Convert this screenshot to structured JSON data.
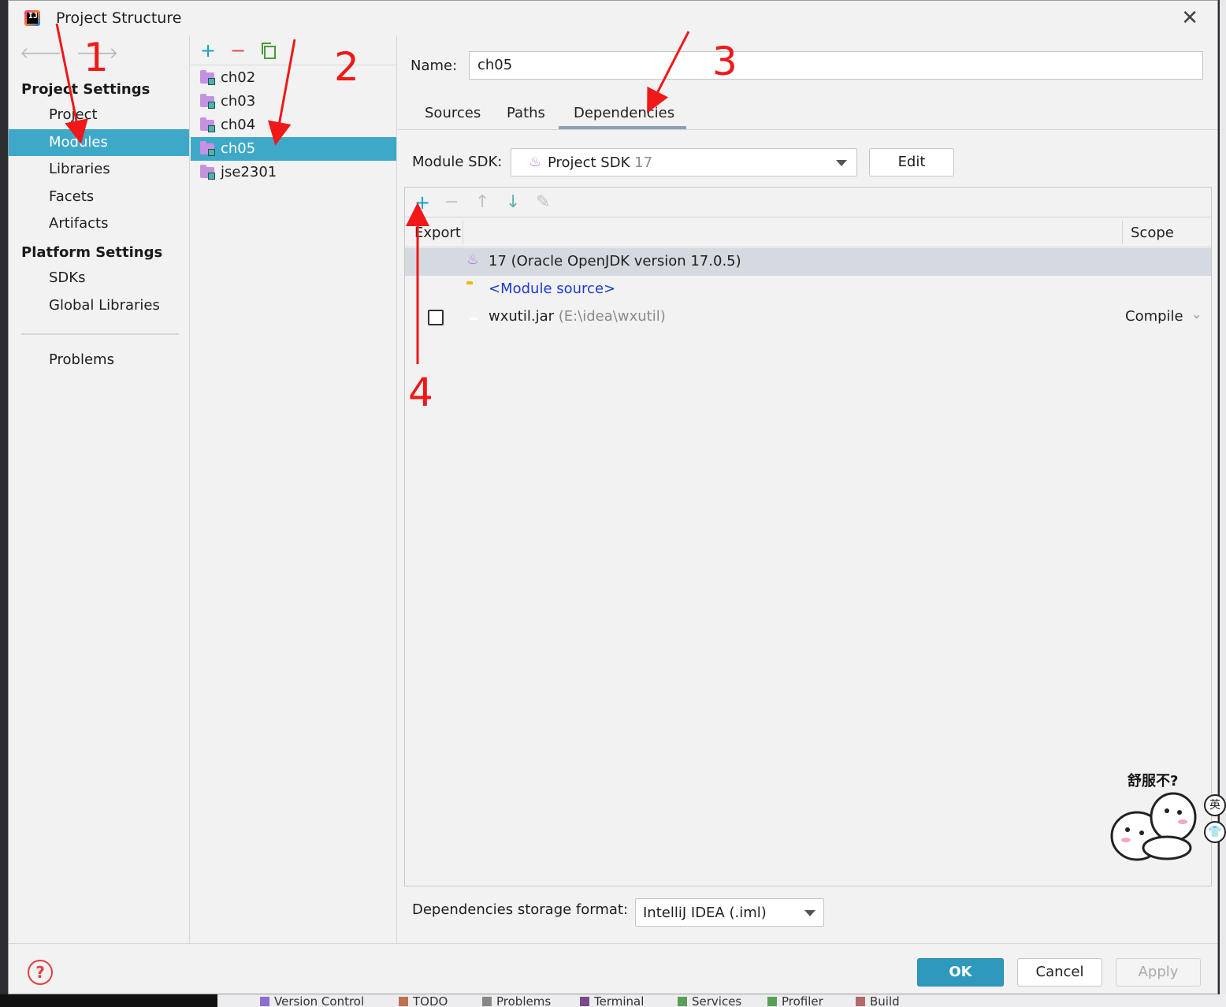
{
  "window": {
    "title": "Project Structure"
  },
  "nav": {
    "project_settings_label": "Project Settings",
    "project_settings_items": [
      "Project",
      "Modules",
      "Libraries",
      "Facets",
      "Artifacts"
    ],
    "platform_settings_label": "Platform Settings",
    "platform_settings_items": [
      "SDKs",
      "Global Libraries"
    ],
    "problems_label": "Problems",
    "selected": "Modules"
  },
  "modules": {
    "items": [
      "ch02",
      "ch03",
      "ch04",
      "ch05",
      "jse2301"
    ],
    "selected": "ch05"
  },
  "detail": {
    "name_label": "Name:",
    "name_value": "ch05",
    "tabs": [
      "Sources",
      "Paths",
      "Dependencies"
    ],
    "active_tab": "Dependencies",
    "module_sdk_label": "Module SDK:",
    "module_sdk_value": "Project SDK",
    "module_sdk_version": "17",
    "edit_label": "Edit",
    "dependencies": {
      "headers": {
        "export": "Export",
        "scope": "Scope"
      },
      "rows": [
        {
          "text": "17 (Oracle OpenJDK version 17.0.5)",
          "icon": "java-icon"
        },
        {
          "text": "<Module source>",
          "icon": "folder-icon"
        },
        {
          "text": "wxutil.jar",
          "path": "(E:\\idea\\wxutil)",
          "icon": "jar-icon",
          "scope": "Compile"
        }
      ]
    },
    "storage_format_label": "Dependencies storage format:",
    "storage_format_value": "IntelliJ IDEA (.iml)"
  },
  "footer": {
    "ok": "OK",
    "cancel": "Cancel",
    "apply": "Apply",
    "help": "?"
  },
  "annotations": [
    "1",
    "2",
    "3",
    "4"
  ],
  "sticker": {
    "caption": "舒服不?",
    "side_glyph": "英"
  },
  "ide_toolwindows": [
    "Version Control",
    "TODO",
    "Problems",
    "Terminal",
    "Services",
    "Profiler",
    "Build"
  ],
  "colors": {
    "selection": "#3ea8c8",
    "annotation": "#f01818",
    "ok_button": "#2f98bd",
    "link": "#1b3bd1"
  }
}
